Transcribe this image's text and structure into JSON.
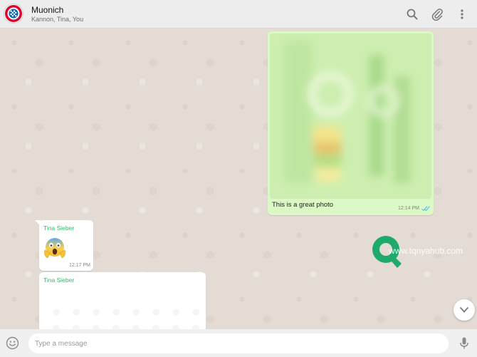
{
  "header": {
    "title": "Muonich",
    "members": "Kannon, Tina, You",
    "icons": [
      "search-icon",
      "attach-icon",
      "menu-icon"
    ]
  },
  "messages": [
    {
      "direction": "out",
      "type": "image",
      "caption": "This is a great photo",
      "time": "12:14 PM",
      "status": "read"
    },
    {
      "direction": "in",
      "sender": "Tina Sieber",
      "type": "emoji",
      "emoji": "face-screaming-in-fear",
      "time": "12:17 PM"
    },
    {
      "direction": "in",
      "sender": "Tina Sieber",
      "type": "image-loading"
    }
  ],
  "watermark": {
    "text": "www.tqnyahub.com"
  },
  "composer": {
    "placeholder": "Type a message",
    "value": ""
  },
  "colors": {
    "header_bg": "#ededed",
    "chat_bg": "#e5ddd5",
    "outgoing_bubble": "#dcf8c6",
    "incoming_bubble": "#ffffff",
    "sender_name": "#35b66b",
    "read_ticks": "#4fc3f7"
  }
}
